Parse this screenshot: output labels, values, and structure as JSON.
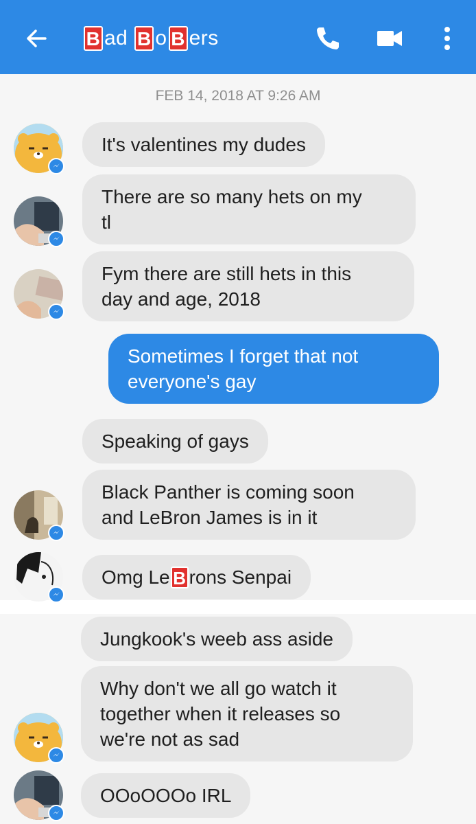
{
  "header": {
    "title_parts": [
      "B",
      "ad ",
      "B",
      "o",
      "B",
      "ers"
    ],
    "accent_color": "#2d89e5",
    "emoji_color": "#e1312e",
    "icons": [
      "back-arrow-icon",
      "phone-icon",
      "video-camera-icon",
      "more-vertical-icon"
    ]
  },
  "conversation": {
    "timestamp": "FEB 14, 2018 AT 9:26 AM",
    "messages": [
      {
        "from": "other",
        "text": "It's valentines my dudes"
      },
      {
        "from": "other",
        "text_lines": [
          "There are so many hets on my",
          "tl"
        ]
      },
      {
        "from": "other",
        "text_lines": [
          "Fym there are still hets in this",
          "day and age, 2018"
        ]
      },
      {
        "from": "me",
        "text_lines": [
          "Sometimes I forget that not",
          "everyone's gay"
        ]
      },
      {
        "from": "other",
        "text": "Speaking of gays"
      },
      {
        "from": "other",
        "text_lines": [
          "Black Panther is coming soon",
          "and LeBron James is in it"
        ]
      },
      {
        "from": "other",
        "text_parts": [
          "Omg Le",
          "B",
          "rons Senpai"
        ]
      },
      {
        "from": "other",
        "text": "Jungkook's weeb ass aside"
      },
      {
        "from": "other",
        "text_lines": [
          "Why don't we all go watch it",
          "together when it releases so",
          "we're not as sad"
        ]
      },
      {
        "from": "other",
        "text": "OOoOOOo IRL"
      }
    ]
  }
}
